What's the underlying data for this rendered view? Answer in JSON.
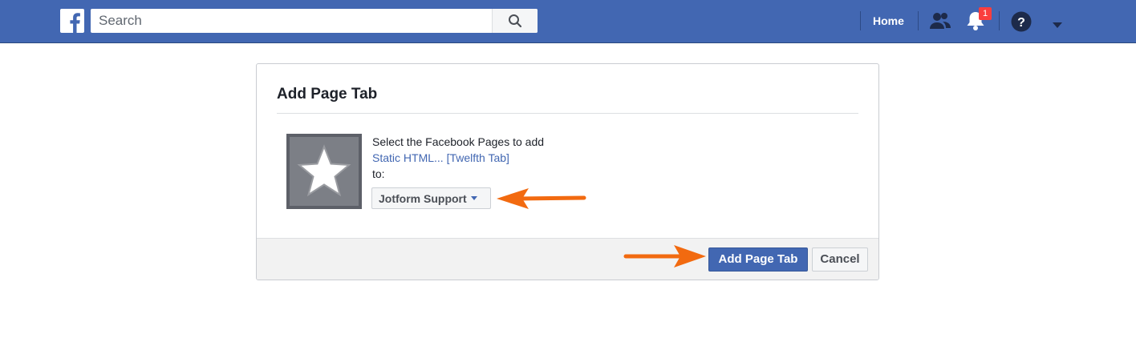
{
  "header": {
    "logo": "f",
    "search": {
      "placeholder": "Search",
      "value": "",
      "icon": "search-icon"
    },
    "nav": {
      "home_label": "Home",
      "friends_icon": "friends-icon",
      "notifications_icon": "bell-icon",
      "notification_count": "1",
      "help_icon": "help-icon",
      "menu_icon": "caret-down-icon"
    },
    "colors": {
      "bar": "#4267b2",
      "badge": "#fa3e3e"
    }
  },
  "dialog": {
    "title": "Add Page Tab",
    "app_icon": "star-icon",
    "select_prompt": "Select the Facebook Pages to add",
    "app_name": "Static HTML... [Twelfth Tab]",
    "to_label": "to:",
    "page_select": {
      "selected": "Jotform Support"
    },
    "primary_button": "Add Page Tab",
    "cancel_button": "Cancel",
    "annotations": {
      "arrow_color": "#f26a10",
      "arrows": [
        "arrow-to-page-select",
        "arrow-to-add-button"
      ]
    }
  }
}
